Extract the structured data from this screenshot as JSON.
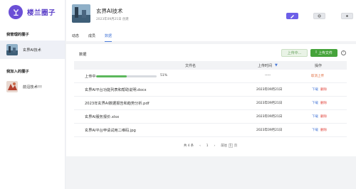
{
  "app": {
    "name": "楼兰圈子"
  },
  "sidebar": {
    "managed_title": "我管理的圈子",
    "managed_items": [
      {
        "label": "玄界AI技术"
      }
    ],
    "joined_title": "我加入的圈子",
    "joined_items": [
      {
        "label": "前沿技术!!!"
      }
    ]
  },
  "header": {
    "title": "玄界AI技术",
    "created": "2023年09月21日 创建",
    "tabs": [
      {
        "label": "动态"
      },
      {
        "label": "成员"
      },
      {
        "label": "数据"
      }
    ],
    "active_tab": "数据"
  },
  "data_panel": {
    "title": "数据",
    "uploading_label": "上传中...",
    "upload_label": "上传文件",
    "columns": {
      "name": "文件名",
      "time": "上传时间",
      "action": "操作"
    },
    "uploading_row": {
      "name": "上传中",
      "progress": 0.51,
      "progress_text": "51%",
      "time": "-----",
      "cancel": "取消上传"
    },
    "rows": [
      {
        "name": "玄界AI平台功能列表和帮助说明.docx",
        "time": "2023年09月21日"
      },
      {
        "name": "2023年玄界AI数据报告和趋势分析.pdf",
        "time": "2023年09月21日"
      },
      {
        "name": "玄界AI服务报价.xlsx",
        "time": "2023年09月21日"
      },
      {
        "name": "玄界AI平台申请试用二维码.jpg",
        "time": "2023年09月21日"
      }
    ],
    "download_label": "下载",
    "delete_label": "删除",
    "pagination": {
      "total": "共 4 条",
      "prev": "‹",
      "page": "1",
      "next": "›",
      "goto": "前往",
      "goto_page": "1",
      "goto_suffix": "页"
    }
  },
  "colors": {
    "brand": "#6b4fd6",
    "green": "#45a33a",
    "link": "#4a7ad8",
    "danger": "#e0443c"
  },
  "icons": [
    "logo-icon",
    "edit-icon",
    "settings-icon",
    "upload-icon",
    "info-icon",
    "sort-icon"
  ]
}
